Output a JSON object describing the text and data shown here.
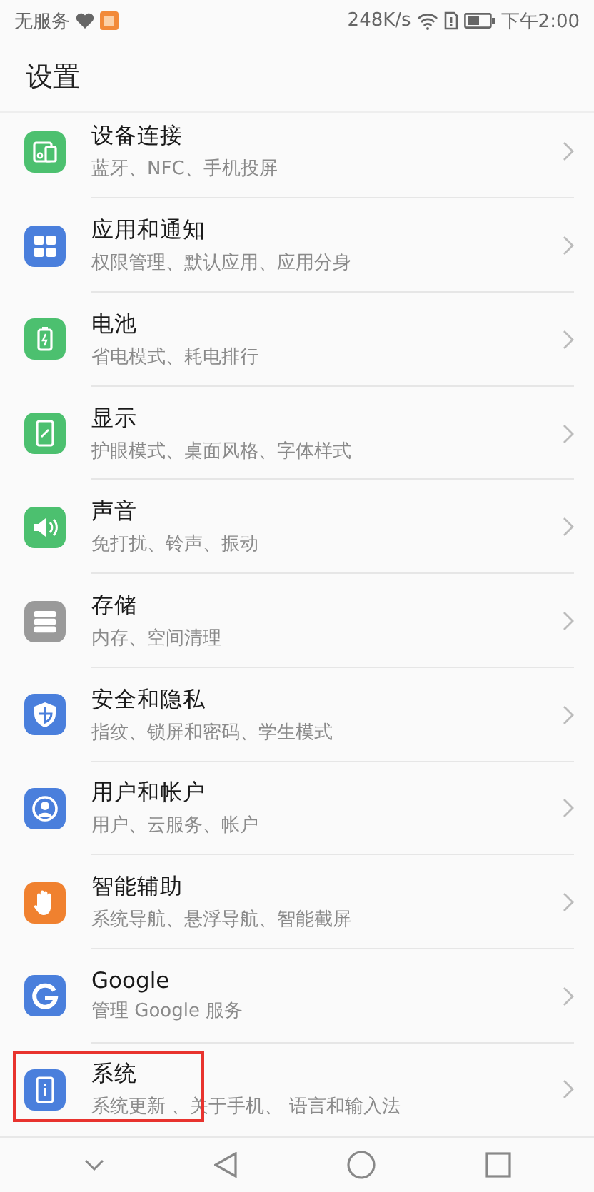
{
  "status_bar": {
    "carrier": "无服务",
    "speed": "248K/s",
    "time": "下午2:00"
  },
  "header": {
    "title": "设置"
  },
  "items": [
    {
      "title": "设备连接",
      "subtitle": "蓝牙、NFC、手机投屏",
      "color": "#4cc06f",
      "highlighted": false
    },
    {
      "title": "应用和通知",
      "subtitle": "权限管理、默认应用、应用分身",
      "color": "#4a7fdc",
      "highlighted": false
    },
    {
      "title": "电池",
      "subtitle": "省电模式、耗电排行",
      "color": "#4cc06f",
      "highlighted": false
    },
    {
      "title": "显示",
      "subtitle": "护眼模式、桌面风格、字体样式",
      "color": "#4cc06f",
      "highlighted": false
    },
    {
      "title": "声音",
      "subtitle": "免打扰、铃声、振动",
      "color": "#4cc06f",
      "highlighted": false
    },
    {
      "title": "存储",
      "subtitle": "内存、空间清理",
      "color": "#9a9a9a",
      "highlighted": false
    },
    {
      "title": "安全和隐私",
      "subtitle": "指纹、锁屏和密码、学生模式",
      "color": "#4a7fdc",
      "highlighted": false
    },
    {
      "title": "用户和帐户",
      "subtitle": "用户、云服务、帐户",
      "color": "#4a7fdc",
      "highlighted": false
    },
    {
      "title": "智能辅助",
      "subtitle": "系统导航、悬浮导航、智能截屏",
      "color": "#f0812f",
      "highlighted": false
    },
    {
      "title": "Google",
      "subtitle": "管理 Google 服务",
      "color": "#4a7fdc",
      "highlighted": false
    },
    {
      "title": "系统",
      "subtitle": "系统更新 、关于手机、 语言和输入法",
      "color": "#4a7fdc",
      "highlighted": true
    }
  ]
}
